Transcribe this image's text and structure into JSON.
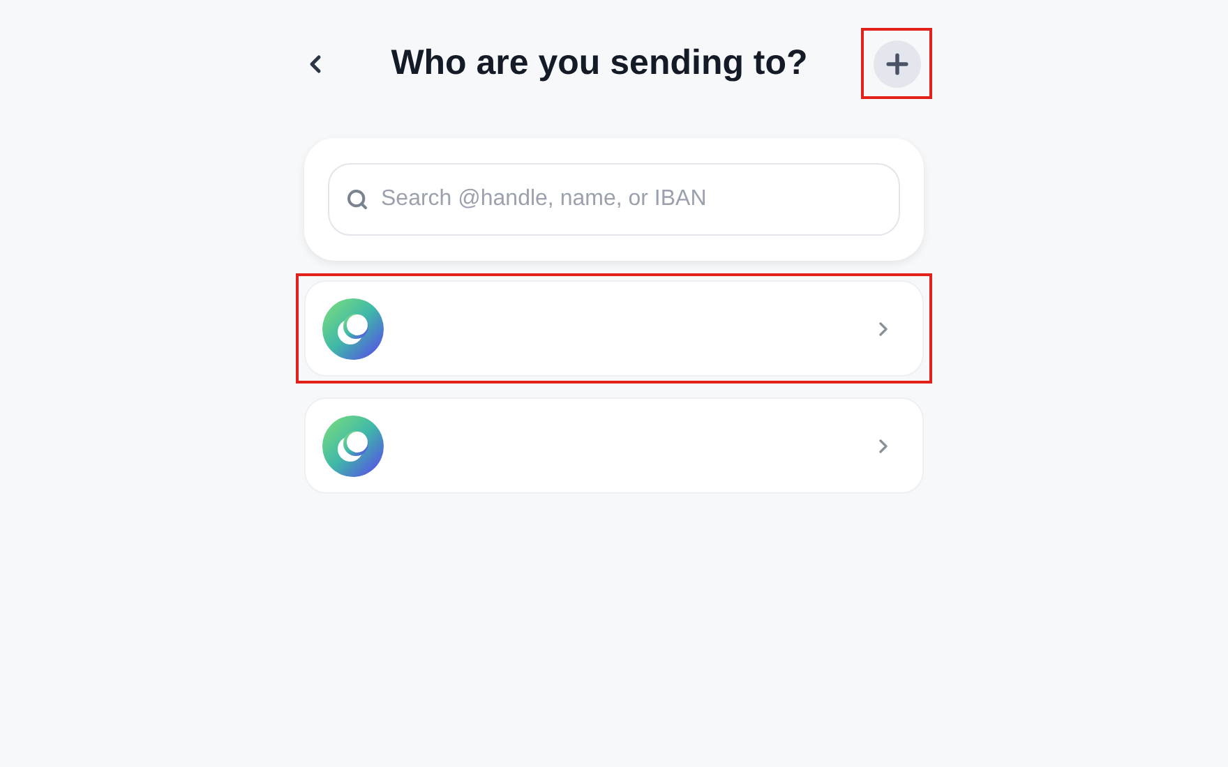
{
  "header": {
    "title": "Who are you sending to?",
    "add_button": {
      "highlighted": true
    }
  },
  "search": {
    "placeholder": "Search @handle, name, or IBAN"
  },
  "recipients": [
    {
      "highlighted": true
    },
    {
      "highlighted": false
    }
  ]
}
